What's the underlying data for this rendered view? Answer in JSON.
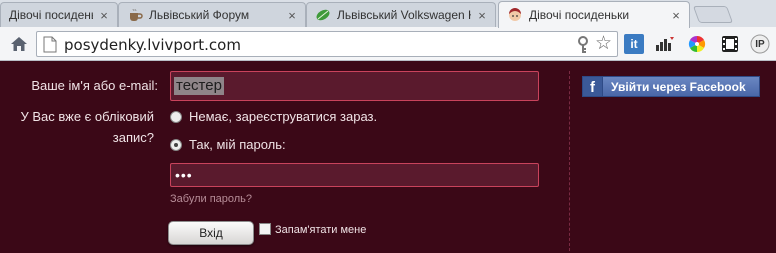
{
  "browser": {
    "tabs": [
      {
        "title": "Дівочі посиденьки",
        "icon": "girl-face-icon",
        "active": false
      },
      {
        "title": "Львівський Форум",
        "icon": "coffee-cup-icon",
        "active": false
      },
      {
        "title": "Львівський Volkswagen Клуб",
        "icon": "leaf-icon",
        "active": false
      },
      {
        "title": "Дівочі посиденьки",
        "icon": "girl-face-icon",
        "active": true
      }
    ],
    "close_glyph": "×",
    "url": "posydenky.lvivport.com",
    "extensions": [
      {
        "name": "it",
        "label": "it"
      },
      {
        "name": "bars-chart-icon",
        "label": ""
      },
      {
        "name": "color-wheel-icon",
        "label": ""
      },
      {
        "name": "film-icon",
        "label": ""
      },
      {
        "name": "ip-icon",
        "label": "IP"
      }
    ]
  },
  "login": {
    "email_label": "Ваше ім'я або e-mail:",
    "email_value": "тестер",
    "account_question_line1": "У Вас вже є обліковий",
    "account_question_line2": "запис?",
    "option_no": "Немає, зареєструватися зараз.",
    "option_yes": "Так, мій пароль:",
    "selected_option": "option_yes",
    "password_masked": "•••",
    "forgot_password": "Забули пароль?",
    "submit_label": "Вхід",
    "remember_label": "Запам'ятати мене",
    "remember_checked": false
  },
  "social": {
    "facebook_label": "Увійти через Facebook",
    "facebook_icon": "f"
  },
  "colors": {
    "page_bg": "#3b0817",
    "field_border": "#c9435c",
    "facebook_blue": "#3b5998"
  }
}
